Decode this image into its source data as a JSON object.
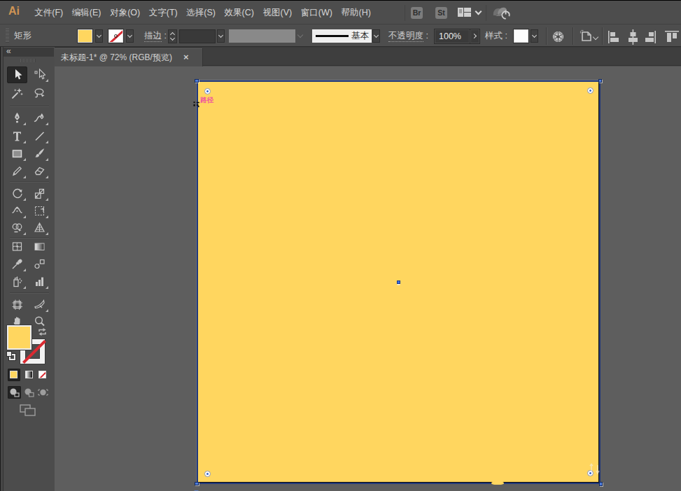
{
  "app": {
    "logo": "Ai",
    "menu_items": [
      "文件(F)",
      "编辑(E)",
      "对象(O)",
      "文字(T)",
      "选择(S)",
      "效果(C)",
      "视图(V)",
      "窗口(W)",
      "帮助(H)"
    ],
    "bridge_button": "Br",
    "stock_button": "St"
  },
  "control_bar": {
    "context_label": "矩形",
    "stroke_label": "描边",
    "colon": ":",
    "stroke_value": "",
    "brush_definition": "基本",
    "opacity_label": "不透明度",
    "opacity_value": "100%",
    "style_label": "样式"
  },
  "document_tab": {
    "title": "未标题-1* @ 72% (RGB/预览)",
    "close_glyph": "×",
    "zoom_percent": "72%",
    "color_mode": "RGB",
    "view_mode": "预览"
  },
  "toolbar": {
    "collapse_glyph": "«",
    "tools": [
      {
        "name": "selection-tool",
        "active": true,
        "flyout": false
      },
      {
        "name": "direct-selection-tool",
        "active": false,
        "flyout": true
      },
      {
        "name": "magic-wand-tool",
        "active": false,
        "flyout": false
      },
      {
        "name": "lasso-tool",
        "active": false,
        "flyout": false
      },
      {
        "name": "pen-tool",
        "active": false,
        "flyout": true
      },
      {
        "name": "curvature-tool",
        "active": false,
        "flyout": true
      },
      {
        "name": "type-tool",
        "active": false,
        "flyout": true
      },
      {
        "name": "line-segment-tool",
        "active": false,
        "flyout": true
      },
      {
        "name": "rectangle-tool",
        "active": false,
        "flyout": true
      },
      {
        "name": "paintbrush-tool",
        "active": false,
        "flyout": true
      },
      {
        "name": "pencil-tool",
        "active": false,
        "flyout": true
      },
      {
        "name": "eraser-tool",
        "active": false,
        "flyout": true
      },
      {
        "name": "rotate-tool",
        "active": false,
        "flyout": true
      },
      {
        "name": "scale-tool",
        "active": false,
        "flyout": true
      },
      {
        "name": "width-tool",
        "active": false,
        "flyout": true
      },
      {
        "name": "free-transform-tool",
        "active": false,
        "flyout": true
      },
      {
        "name": "shape-builder-tool",
        "active": false,
        "flyout": true
      },
      {
        "name": "perspective-grid-tool",
        "active": false,
        "flyout": true
      },
      {
        "name": "mesh-tool",
        "active": false,
        "flyout": false
      },
      {
        "name": "gradient-tool",
        "active": false,
        "flyout": false
      },
      {
        "name": "eyedropper-tool",
        "active": false,
        "flyout": true
      },
      {
        "name": "blend-tool",
        "active": false,
        "flyout": false
      },
      {
        "name": "symbol-sprayer-tool",
        "active": false,
        "flyout": true
      },
      {
        "name": "column-graph-tool",
        "active": false,
        "flyout": true
      },
      {
        "name": "artboard-tool",
        "active": false,
        "flyout": false
      },
      {
        "name": "slice-tool",
        "active": false,
        "flyout": true
      },
      {
        "name": "hand-tool",
        "active": false,
        "flyout": true
      },
      {
        "name": "zoom-tool",
        "active": false,
        "flyout": false
      }
    ]
  },
  "canvas": {
    "smart_guide_label": "路径"
  },
  "colors": {
    "artboard_fill": "#ffd65f",
    "selection_outline": "#22397a",
    "anchor_handle": "#4c7ce0",
    "smart_guide_pink": "#f0549e",
    "logo_orange": "#cf9454",
    "ui_background": "#4d4d4d",
    "canvas_background": "#5e5e5e",
    "stroke_none_red": "#d92b32"
  }
}
